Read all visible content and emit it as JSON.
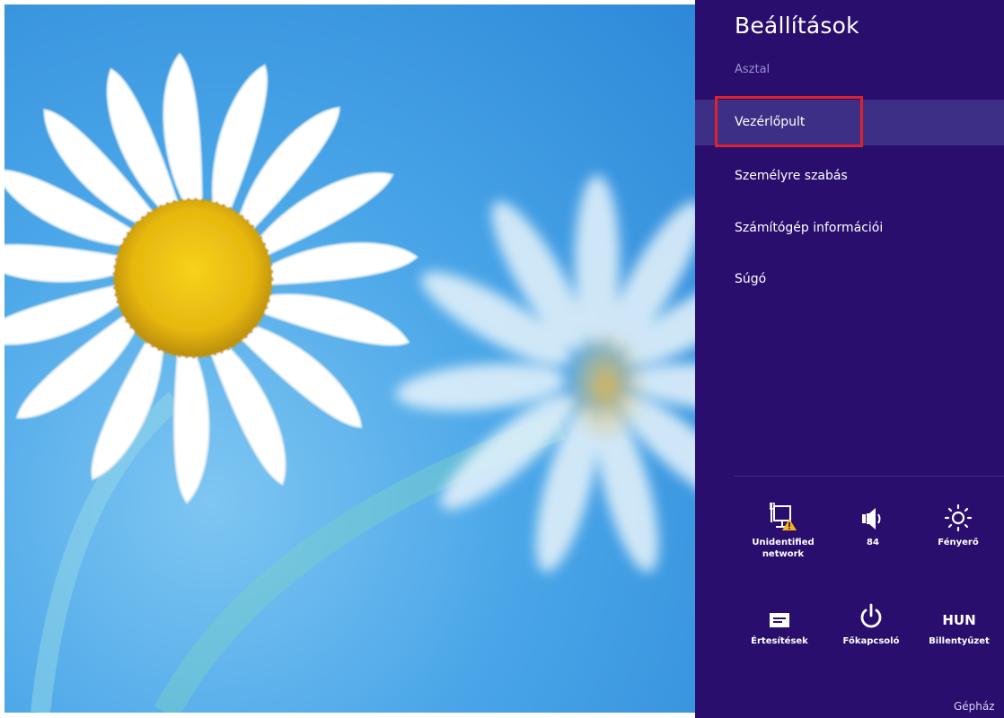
{
  "charm": {
    "title": "Beállítások",
    "subtitle": "Asztal",
    "menu": [
      {
        "label": "Vezérlőpult",
        "selected": true
      },
      {
        "label": "Személyre szabás"
      },
      {
        "label": "Számítógép információi"
      },
      {
        "label": "Súgó"
      }
    ],
    "quick_settings": [
      {
        "icon": "network-warning-icon",
        "label": "Unidentified network"
      },
      {
        "icon": "speaker-icon",
        "label": "84"
      },
      {
        "icon": "brightness-icon",
        "label": "Fényerő"
      },
      {
        "icon": "notifications-icon",
        "label": "Értesítések"
      },
      {
        "icon": "power-icon",
        "label": "Főkapcsoló"
      },
      {
        "icon": "keyboard-icon",
        "label": "Billentyűzet",
        "glyph": "HUN"
      }
    ],
    "footer": "Gépház"
  },
  "colors": {
    "charm_background": "#2a0e6e",
    "selected_item": "#3c2f85",
    "highlight": "#e0212b",
    "desktop_sky": "#4aa6e8"
  }
}
